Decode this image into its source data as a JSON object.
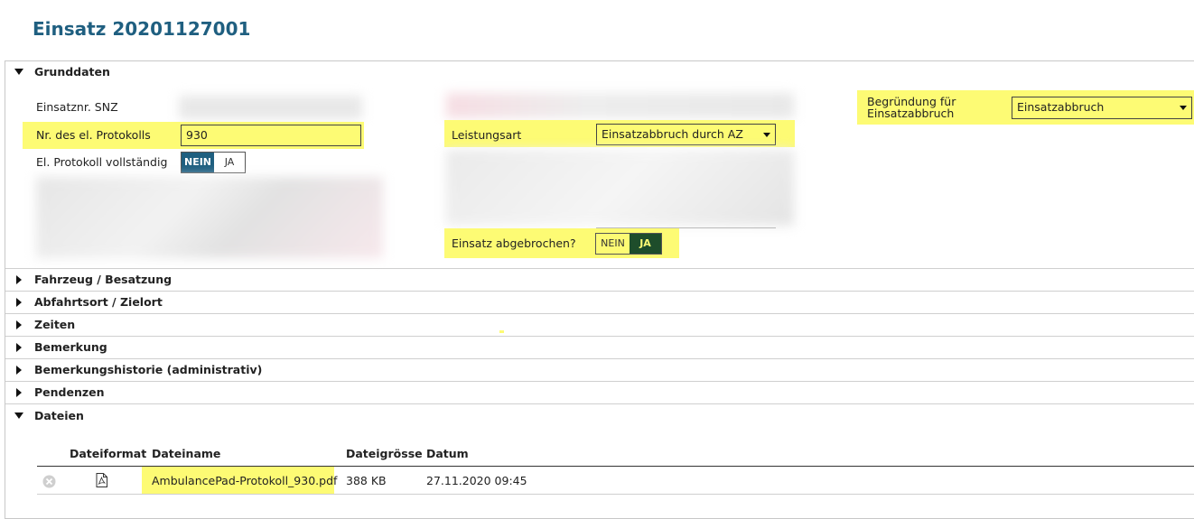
{
  "title": "Einsatz 20201127001",
  "sections": {
    "grunddaten": "Grunddaten",
    "fahrzeug": "Fahrzeug / Besatzung",
    "abfahrtsort": "Abfahrtsort / Zielort",
    "zeiten": "Zeiten",
    "bemerkung": "Bemerkung",
    "bemerkungshistorie": "Bemerkungshistorie (administrativ)",
    "pendenzen": "Pendenzen",
    "dateien": "Dateien"
  },
  "grunddaten": {
    "einsatznr_label": "Einsatznr. SNZ",
    "protokoll_nr_label": "Nr. des el. Protokolls",
    "protokoll_nr_value": "930",
    "protokoll_vollstaendig_label": "El. Protokoll vollständig",
    "vollstaendig_nein": "NEIN",
    "vollstaendig_ja": "JA",
    "leistungsart_label": "Leistungsart",
    "leistungsart_value": "Einsatzabbruch durch AZ",
    "abgebrochen_label": "Einsatz abgebrochen?",
    "abgebrochen_nein": "NEIN",
    "abgebrochen_ja": "JA",
    "begruendung_label_line1": "Begründung für",
    "begruendung_label_line2": "Einsatzabbruch",
    "begruendung_value": "Einsatzabbruch"
  },
  "dateien": {
    "columns": [
      "Dateiformat",
      "Dateiname",
      "Dateigrösse",
      "Datum"
    ],
    "rows": [
      {
        "dateiname": "AmbulancePad-Protokoll_930.pdf",
        "groesse": "388 KB",
        "datum": "27.11.2020 09:45"
      }
    ]
  },
  "colors": {
    "title": "#1f5f80",
    "highlight": "#fdfb74",
    "toggle_nein_active": "#1f5f80",
    "toggle_ja_active": "#1e4d2b"
  },
  "icons": {
    "expand": "triangle-down",
    "collapse": "triangle-right",
    "delete": "circle-x-icon",
    "pdf": "pdf-file-icon"
  }
}
